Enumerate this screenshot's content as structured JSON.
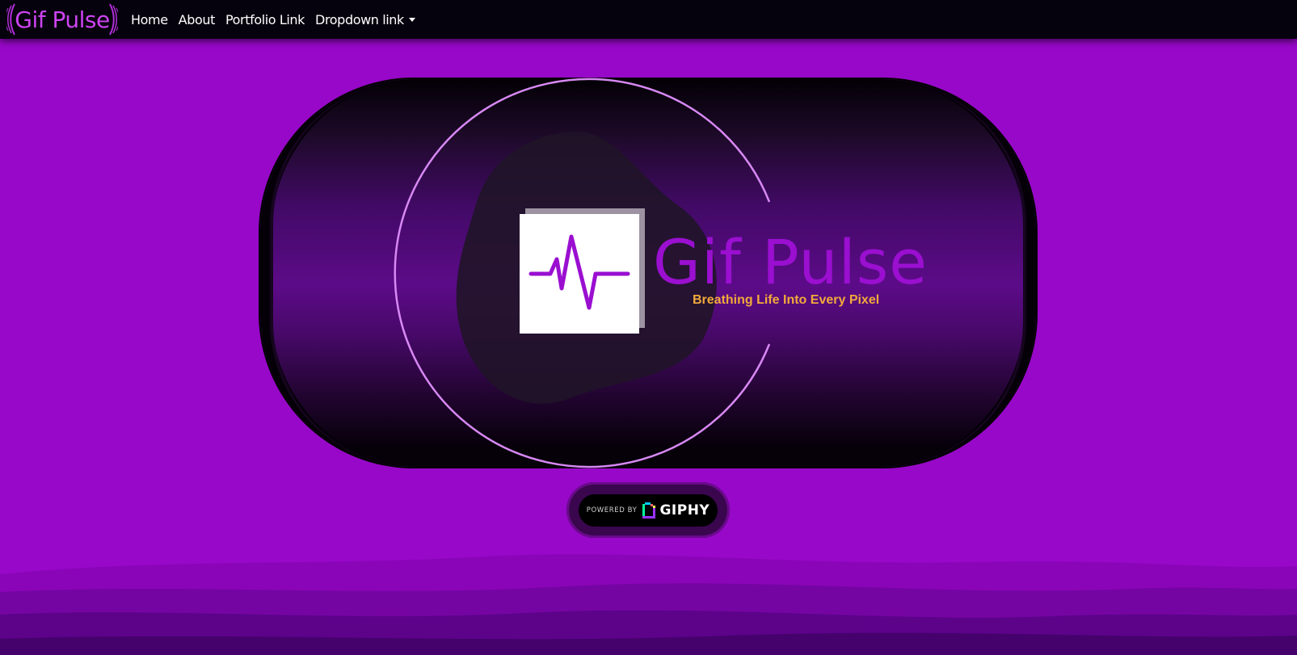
{
  "navbar": {
    "brand": "Gif Pulse",
    "links": [
      {
        "label": "Home"
      },
      {
        "label": "About"
      },
      {
        "label": "Portfolio Link"
      },
      {
        "label": "Dropdown link"
      }
    ]
  },
  "hero": {
    "title": "Gif Pulse",
    "tagline": "Breathing Life Into Every Pixel",
    "logo_icon": "pulse-heartbeat-icon"
  },
  "giphy_badge": {
    "powered_by": "POWERED BY",
    "name": "GIPHY"
  },
  "colors": {
    "background": "#9808c9",
    "navbar": "#06020d",
    "brand_purple": "#cc44f0",
    "title_purple": "#9a0fd0",
    "tagline_orange": "#f2a93b"
  }
}
